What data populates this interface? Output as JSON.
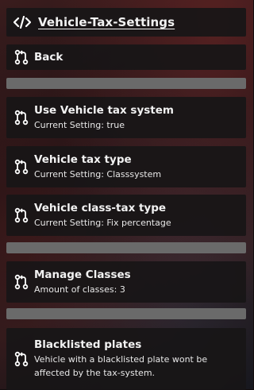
{
  "header": {
    "title": "Vehicle-Tax-Settings"
  },
  "items": [
    {
      "label": "Back",
      "sub": ""
    },
    {
      "label": "Use Vehicle tax system",
      "sub": "Current Setting: true"
    },
    {
      "label": "Vehicle tax type",
      "sub": "Current Setting: Classsystem"
    },
    {
      "label": "Vehicle class-tax type",
      "sub": "Current Setting: Fix percentage"
    },
    {
      "label": "Manage Classes",
      "sub": "Amount of classes: 3"
    },
    {
      "label": "Blacklisted plates",
      "sub": "Vehicle with a blacklisted plate wont be affected by the tax-system."
    }
  ],
  "colors": {
    "panel": "#181617",
    "separator": "#6a6a6a",
    "text": "#f2f2f2"
  },
  "icons": {
    "header": "code-icon",
    "item": "git-pull-request-icon"
  }
}
